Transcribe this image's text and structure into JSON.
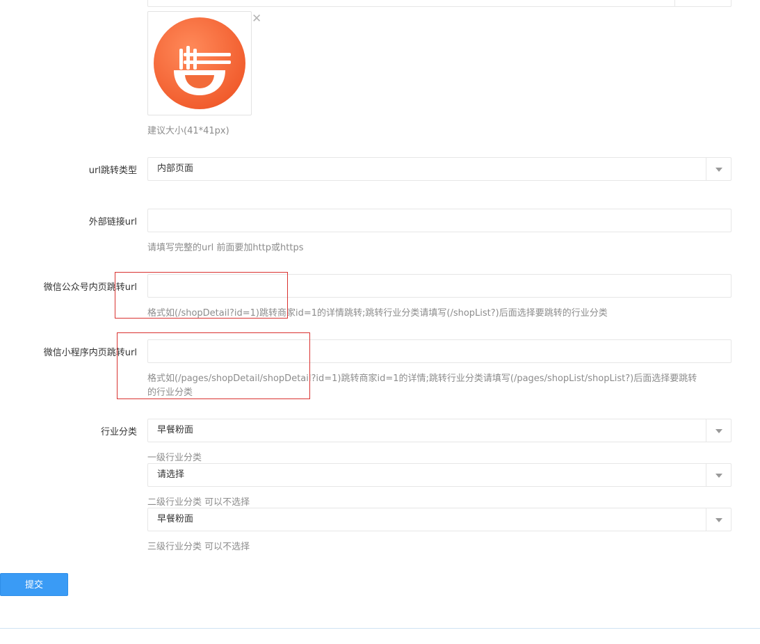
{
  "image": {
    "hint": "建议大小(41*41px)",
    "close_symbol": "✕"
  },
  "url_type": {
    "label": "url跳转类型",
    "value": "内部页面"
  },
  "external_url": {
    "label": "外部链接url",
    "value": "",
    "hint": "请填写完整的url 前面要加http或https"
  },
  "wechat_mp_url": {
    "label": "微信公众号内页跳转url",
    "value": "",
    "hint": "格式如(/shopDetail?id=1)跳转商家id=1的详情跳转;跳转行业分类请填写(/shopList?)后面选择要跳转的行业分类"
  },
  "mini_program_url": {
    "label": "微信小程序内页跳转url",
    "value": "",
    "hint_line1": "格式如(/pages/shopDetail/shopDetail?id=1)跳转商家id=1的详情;跳转行业分类请填写(/pages/shopList/shopList?)后面选择要跳转",
    "hint_line2": "的行业分类"
  },
  "industry": {
    "label": "行业分类",
    "level1_value": "早餐粉面",
    "level1_hint": "一级行业分类",
    "level2_value": "请选择",
    "level2_hint": "二级行业分类 可以不选择",
    "level3_value": "早餐粉面",
    "level3_hint": "三级行业分类 可以不选择"
  },
  "submit_label": "提交",
  "colors": {
    "accent": "#3a9bf5",
    "annotation": "#d9312f",
    "logo": "#f26b3a"
  }
}
